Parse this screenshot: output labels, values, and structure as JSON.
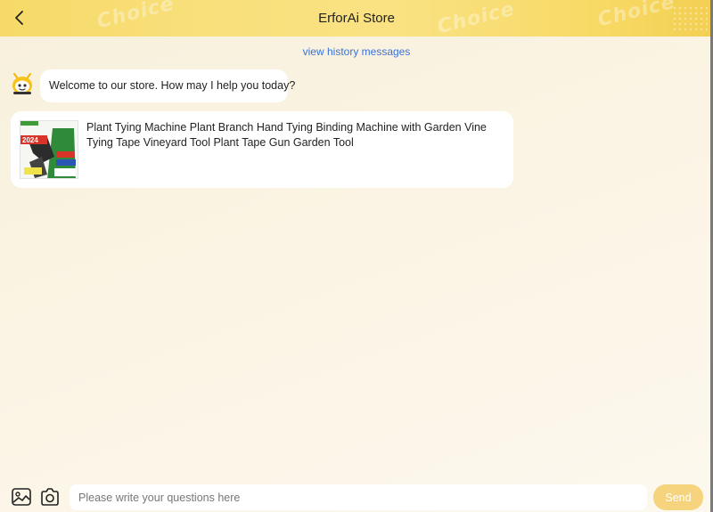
{
  "header": {
    "title": "ErforAi Store",
    "back_icon": "chevron-left-icon",
    "watermark_text": "Choice",
    "colors": {
      "start": "#f6d968",
      "end": "#f3cf52"
    }
  },
  "history": {
    "label": "view history messages"
  },
  "messages": [
    {
      "type": "text",
      "sender": "bot",
      "avatar_icon": "bee-bot-avatar",
      "text": "Welcome to our store. How may I help you today?"
    },
    {
      "type": "product",
      "title": "Plant Tying Machine Plant Branch Hand Tying Binding Machine with Garden Vine Tying Tape Vineyard Tool Plant Tape Gun Garden Tool",
      "thumb_badge": "2024"
    }
  ],
  "input_bar": {
    "gallery_icon": "image-icon",
    "camera_icon": "camera-icon",
    "placeholder": "Please write your questions here",
    "value": "",
    "send_label": "Send",
    "send_color": "#f6d47e"
  },
  "colors": {
    "link": "#3a72d8",
    "background": "#fbf4e4"
  }
}
